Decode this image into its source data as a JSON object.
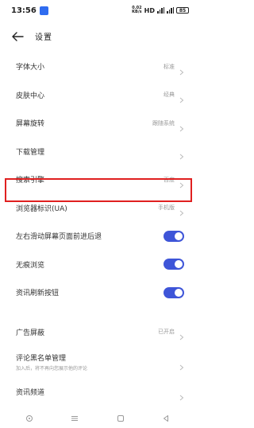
{
  "status_bar": {
    "time": "13:56",
    "net_speed_value": "0.02",
    "net_speed_unit": "KB/s",
    "hd_label": "HD",
    "battery": "85",
    "accent_color": "#2f6cf0"
  },
  "header": {
    "title": "设置"
  },
  "settings": {
    "font_size": {
      "label": "字体大小",
      "value": "标准"
    },
    "skin_center": {
      "label": "皮肤中心",
      "value": "经典"
    },
    "screen_rotation": {
      "label": "屏幕旋转",
      "value": "跟随系统"
    },
    "download_manager": {
      "label": "下载管理"
    },
    "search_engine": {
      "label": "搜索引擎",
      "value": "百度"
    },
    "browser_ua": {
      "label": "浏览器标识(UA)",
      "value": "手机版"
    },
    "swipe_nav": {
      "label": "左右滑动屏幕页面前进后退"
    },
    "incognito": {
      "label": "无痕浏览"
    },
    "news_refresh_button": {
      "label": "资讯刷新按钮"
    },
    "ad_block": {
      "label": "广告屏蔽",
      "value": "已开启"
    },
    "comment_blacklist": {
      "label": "评论黑名单管理",
      "sub": "加入后，将不再向您展示他的评论"
    },
    "news_channel": {
      "label": "资讯频道"
    }
  },
  "colors": {
    "toggle_on": "#3e55d8",
    "highlight": "#e02020"
  }
}
